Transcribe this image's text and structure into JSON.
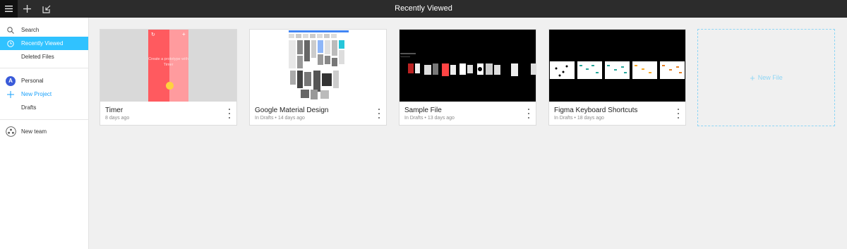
{
  "header": {
    "title": "Recently Viewed"
  },
  "sidebar": {
    "items": [
      {
        "label": "Search"
      },
      {
        "label": "Recently Viewed"
      },
      {
        "label": "Deleted Files"
      },
      {
        "label": "Personal",
        "avatar": "A"
      },
      {
        "label": "New Project"
      },
      {
        "label": "Drafts"
      },
      {
        "label": "New team"
      }
    ]
  },
  "files": [
    {
      "title": "Timer",
      "meta": "8 days ago",
      "thumb_text": "Create a prototype with Timer"
    },
    {
      "title": "Google Material Design",
      "location": "In Drafts",
      "age": "14 days ago"
    },
    {
      "title": "Sample File",
      "location": "In Drafts",
      "age": "13 days ago"
    },
    {
      "title": "Figma Keyboard Shortcuts",
      "location": "In Drafts",
      "age": "18 days ago"
    }
  ],
  "new_file": {
    "label": "New File"
  },
  "colors": {
    "accent": "#30c2ff",
    "link": "#18a0fb",
    "topbar": "#2c2c2c"
  },
  "icons": {
    "menu": "hamburger-icon",
    "add": "plus-icon",
    "import": "import-icon",
    "search": "search-icon",
    "recent": "clock-icon",
    "team": "team-icon"
  }
}
